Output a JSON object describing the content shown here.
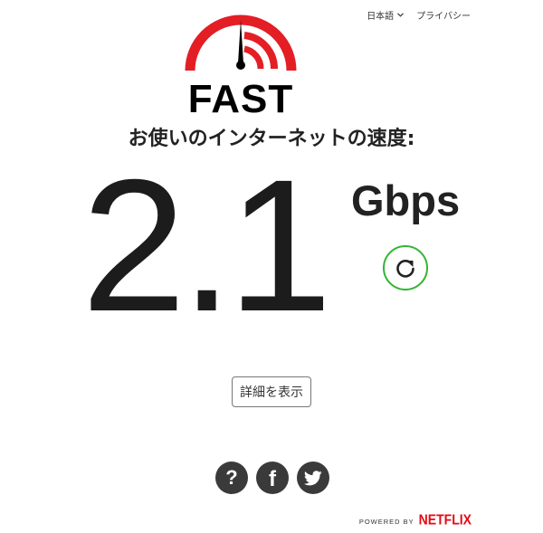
{
  "header": {
    "language_label": "日本語",
    "privacy_label": "プライバシー"
  },
  "logo": {
    "text": "FAST",
    "brand_color": "#e31e24"
  },
  "speed": {
    "label": "お使いのインターネットの速度:",
    "value": "2.1",
    "units": "Gbps"
  },
  "actions": {
    "more_info_label": "詳細を表示",
    "refresh_ring_color": "#35b435"
  },
  "social": {
    "help_label": "?",
    "facebook_label": "f",
    "icons": [
      "question-icon",
      "facebook-icon",
      "twitter-icon"
    ]
  },
  "footer": {
    "powered_by": "POWERED BY",
    "brand": "NETFLIX",
    "brand_color": "#e50914"
  }
}
